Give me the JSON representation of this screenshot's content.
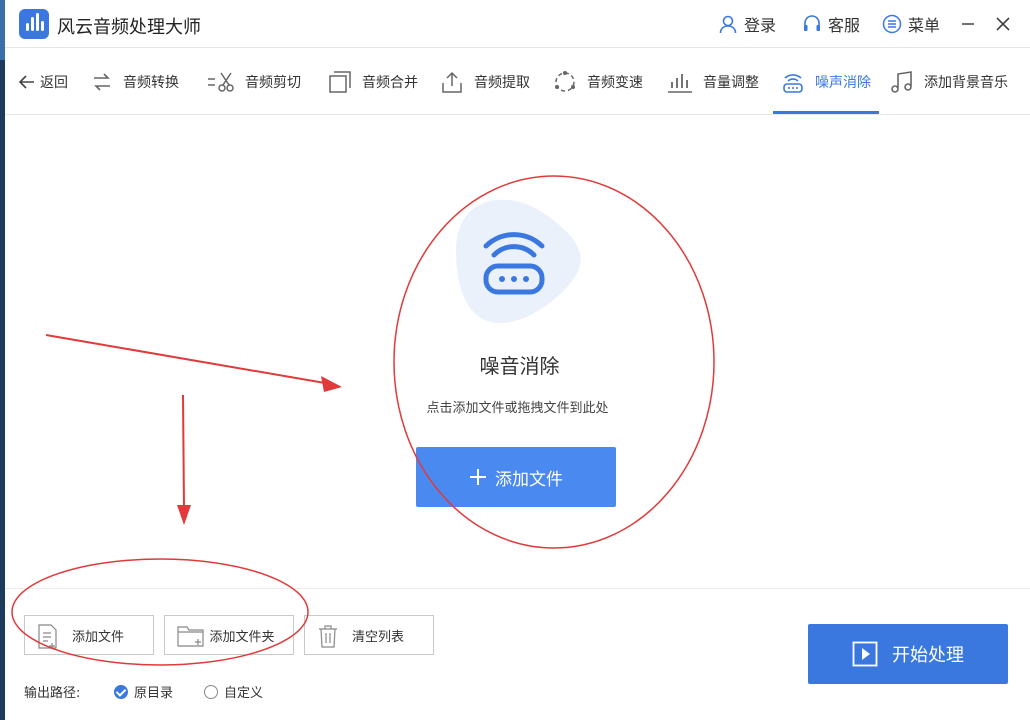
{
  "app": {
    "title": "风云音频处理大师"
  },
  "titlebar": {
    "login": "登录",
    "service": "客服",
    "menu": "菜单"
  },
  "toolbar": {
    "back": "返回",
    "items": [
      "音频转换",
      "音频剪切",
      "音频合并",
      "音频提取",
      "音频变速",
      "音量调整",
      "噪声消除",
      "添加背景音乐"
    ],
    "active_index": 6
  },
  "drop": {
    "title": "噪音消除",
    "hint": "点击添加文件或拖拽文件到此处",
    "add_button": "添加文件"
  },
  "bottom": {
    "add_file": "添加文件",
    "add_folder": "添加文件夹",
    "clear_list": "清空列表",
    "output_label": "输出路径:",
    "option_original": "原目录",
    "option_custom": "自定义",
    "selected": "原目录",
    "start": "开始处理"
  },
  "colors": {
    "accent": "#3a78e0",
    "annotation": "#e03a3a"
  }
}
